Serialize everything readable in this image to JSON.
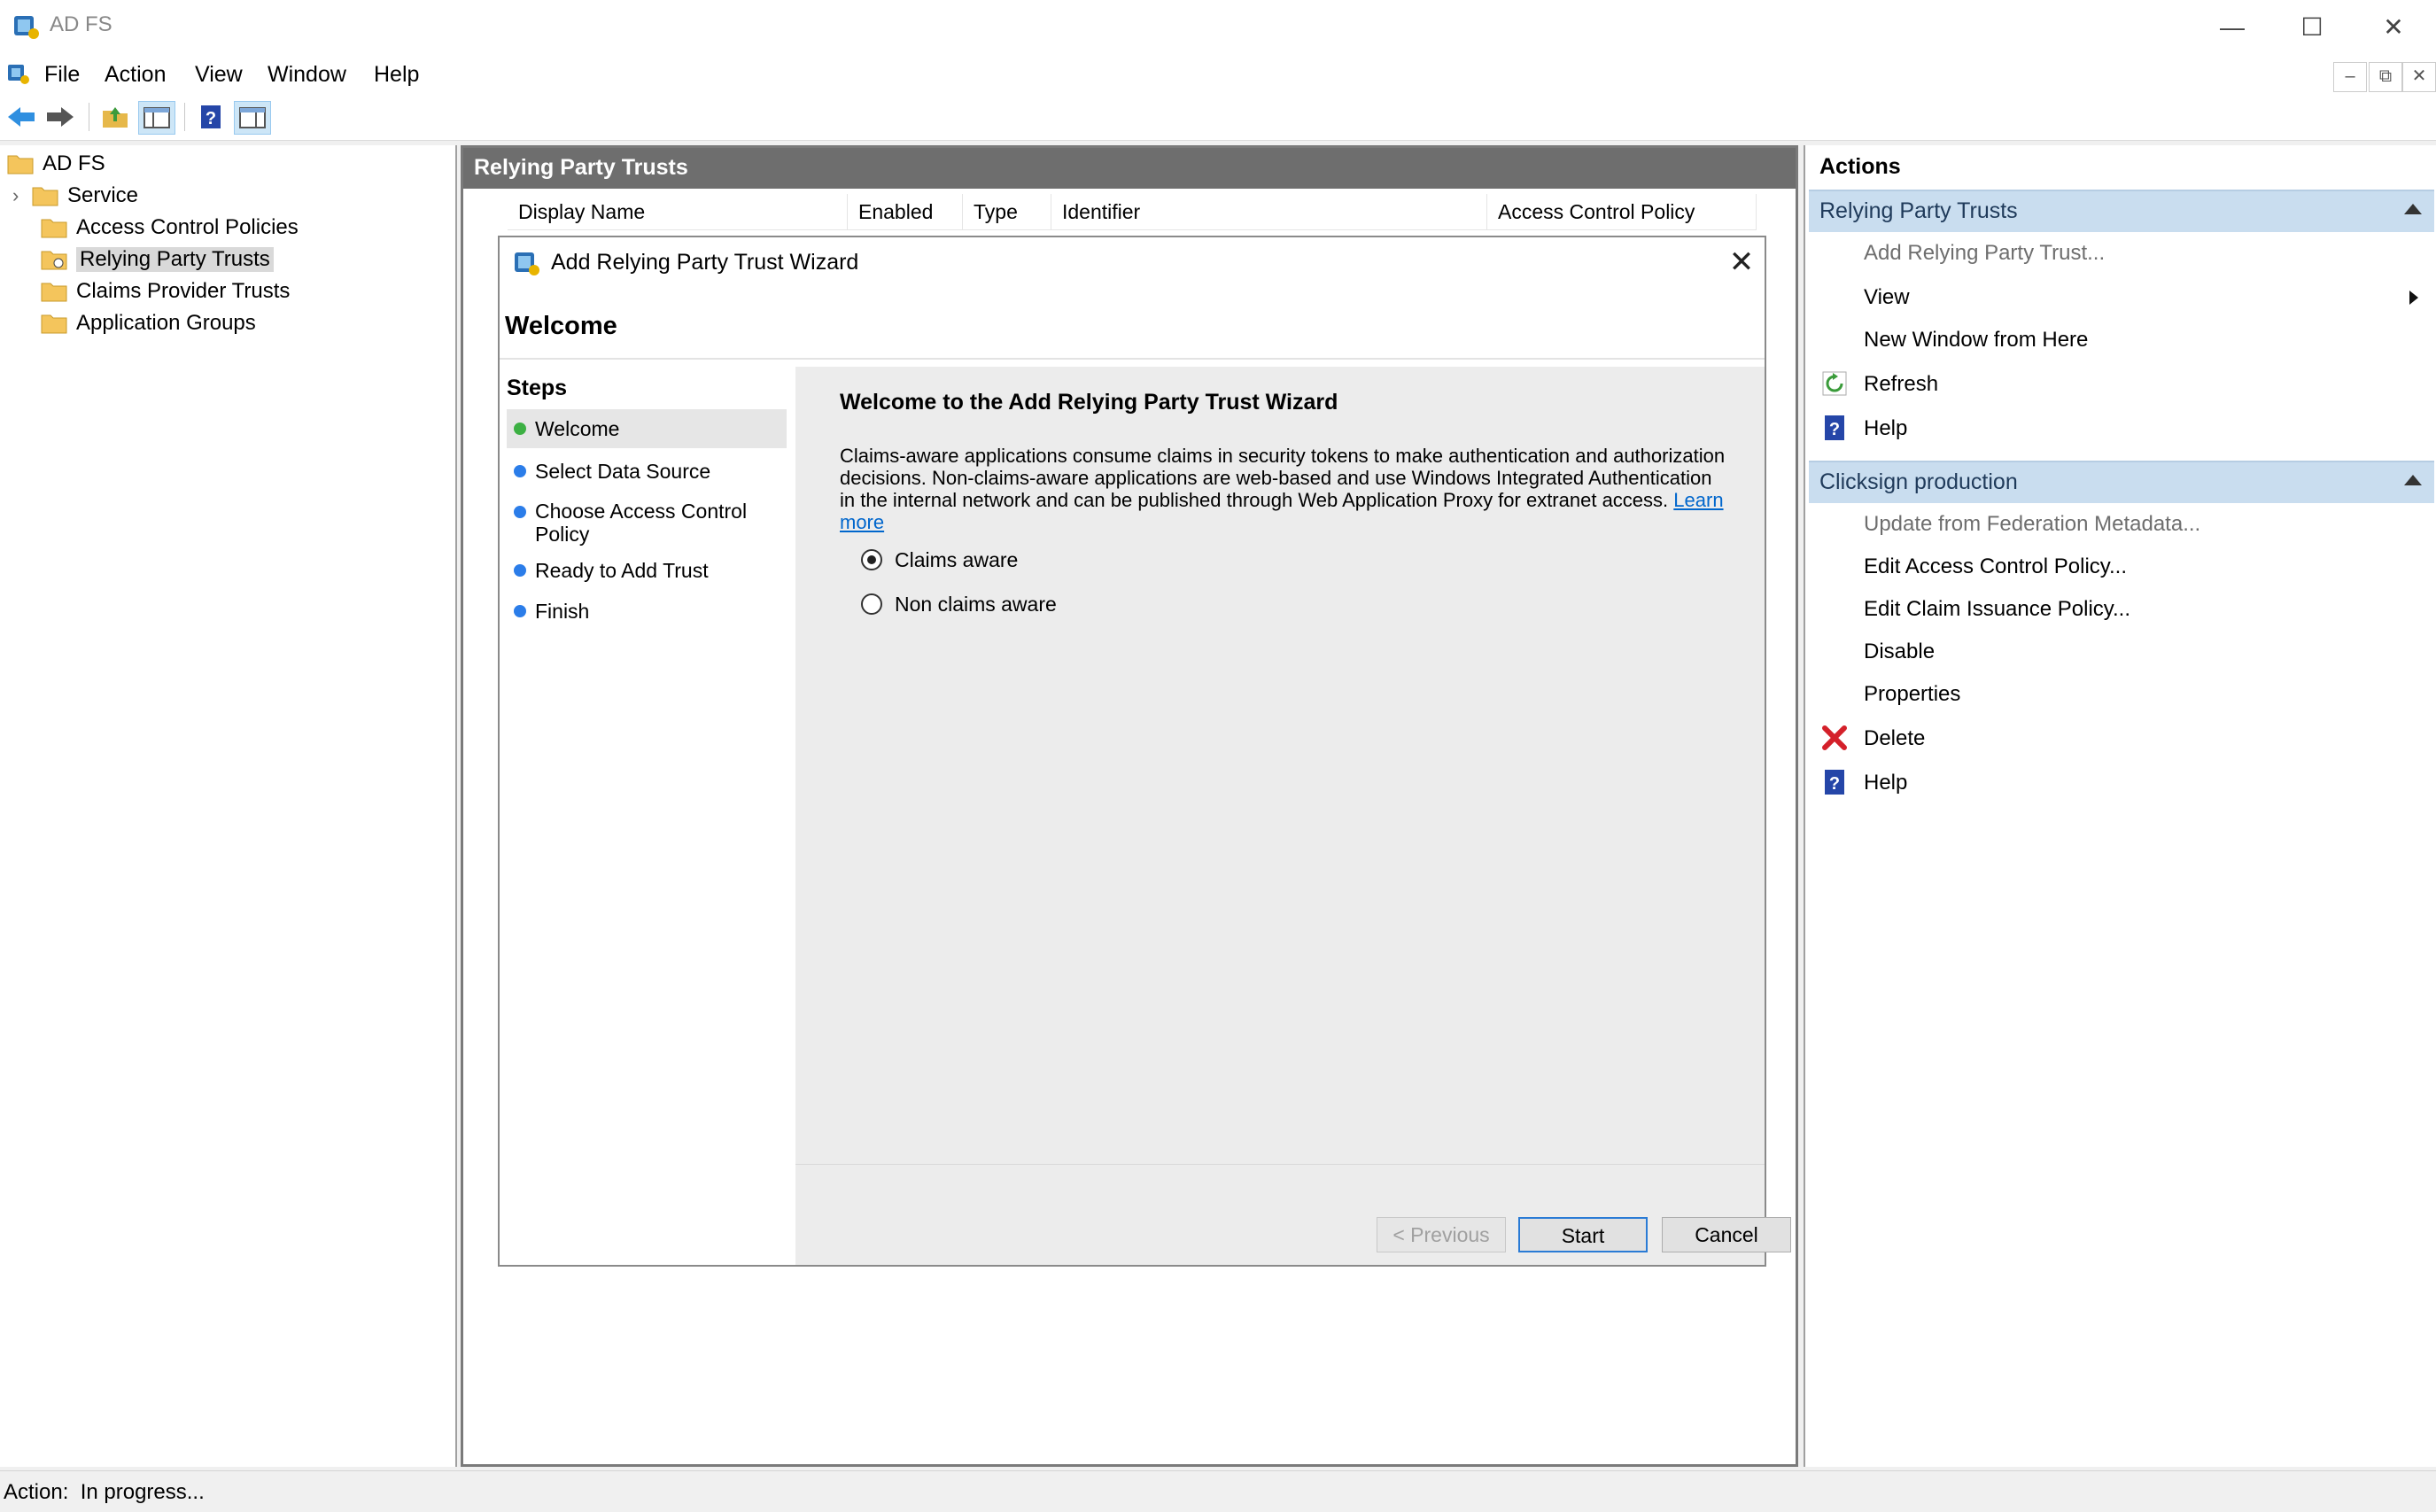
{
  "window": {
    "title": "AD FS",
    "controls": {
      "minimize": "—",
      "maximize": "☐",
      "close": "✕"
    }
  },
  "menu": [
    "File",
    "Action",
    "View",
    "Window",
    "Help"
  ],
  "mdi_controls": [
    "–",
    "⧉",
    "✕"
  ],
  "toolbar": {
    "buttons": [
      "back-arrow-icon",
      "forward-arrow-icon",
      "up-folder-icon",
      "show-hide-tree-icon",
      "help-icon",
      "show-hide-action-pane-icon"
    ]
  },
  "tree": {
    "root": "AD FS",
    "items": [
      {
        "label": "Service",
        "expandable": true
      },
      {
        "label": "Access Control Policies"
      },
      {
        "label": "Relying Party Trusts",
        "selected": true
      },
      {
        "label": "Claims Provider Trusts"
      },
      {
        "label": "Application Groups"
      }
    ]
  },
  "center": {
    "header": "Relying Party Trusts",
    "columns": [
      "Display Name",
      "Enabled",
      "Type",
      "Identifier",
      "Access Control Policy"
    ]
  },
  "actions": {
    "title": "Actions",
    "section1": {
      "title": "Relying Party Trusts",
      "items": [
        {
          "label": "Add Relying Party Trust...",
          "disabled": true
        },
        {
          "label": "View",
          "submenu": true
        },
        {
          "label": "New Window from Here"
        },
        {
          "label": "Refresh",
          "icon": "refresh-icon"
        },
        {
          "label": "Help",
          "icon": "help-icon"
        }
      ]
    },
    "section2": {
      "title": "Clicksign production",
      "items": [
        {
          "label": "Update from Federation Metadata...",
          "disabled": true
        },
        {
          "label": "Edit Access Control Policy..."
        },
        {
          "label": "Edit Claim Issuance Policy..."
        },
        {
          "label": "Disable"
        },
        {
          "label": "Properties"
        },
        {
          "label": "Delete",
          "icon": "delete-icon"
        },
        {
          "label": "Help",
          "icon": "help-icon"
        }
      ]
    }
  },
  "status": {
    "text": "Action:  In progress..."
  },
  "wizard": {
    "title": "Add Relying Party Trust Wizard",
    "close_glyph": "✕",
    "heading": "Welcome",
    "steps_title": "Steps",
    "steps": [
      {
        "label": "Welcome",
        "status": "current",
        "color": "#3cb043"
      },
      {
        "label": "Select Data Source",
        "color": "#2b7de9"
      },
      {
        "label": "Choose Access Control Policy",
        "color": "#2b7de9"
      },
      {
        "label": "Ready to Add Trust",
        "color": "#2b7de9"
      },
      {
        "label": "Finish",
        "color": "#2b7de9"
      }
    ],
    "body_title": "Welcome to the Add Relying Party Trust Wizard",
    "description": "Claims-aware applications consume claims in security tokens to make authentication and authorization decisions. Non-claims-aware applications are web-based and use Windows Integrated Authentication in the internal network and can be published through Web Application Proxy for extranet access.",
    "learn_more": "Learn more",
    "options": [
      {
        "label": "Claims aware",
        "checked": true
      },
      {
        "label": "Non claims aware",
        "checked": false
      }
    ],
    "buttons": {
      "previous": "< Previous",
      "start": "Start",
      "cancel": "Cancel"
    }
  }
}
